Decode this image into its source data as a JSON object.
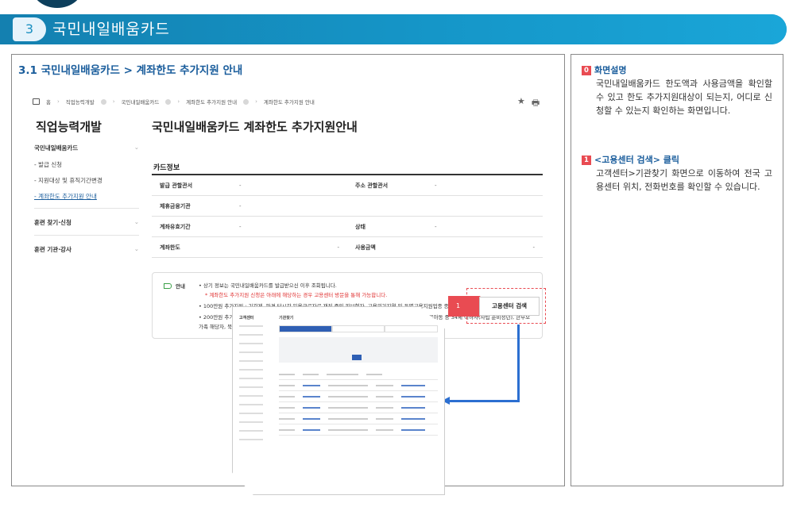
{
  "banner": {
    "number": "3",
    "title": "국민내일배움카드"
  },
  "section_title": "3.1 국민내일배움카드 > 계좌한도 추가지원 안내",
  "breadcrumb": [
    "홈",
    "직업능력개발",
    "국민내일배움카드",
    "계좌한도 추가지원 안내",
    "계좌한도 추가지원 안내"
  ],
  "tools": {
    "star": "★",
    "print": "🖶"
  },
  "nav": {
    "title": "직업능력개발",
    "groups": [
      {
        "label": "국민내일배움카드",
        "chevron": "⌄",
        "items": [
          "- 발급 신청",
          "- 지원대상 및 휴직기간변경",
          "- 계좌한도 추가지원 안내"
        ]
      },
      {
        "label": "훈련 찾기·신청",
        "chevron": "⌄"
      },
      {
        "label": "훈련 기관·강사",
        "chevron": "⌄"
      }
    ]
  },
  "content_title": "국민내일배움카드 계좌한도 추가지원안내",
  "card": {
    "label": "카드정보",
    "rows": [
      {
        "h1": "발급 관할관서",
        "v1": "-",
        "h2": "주소 관할관서",
        "v2": "-"
      },
      {
        "h1": "제휴금융기관",
        "v1": "-"
      },
      {
        "h1": "계좌유효기간",
        "v1": "-",
        "h2": "상태",
        "v2": "-"
      },
      {
        "h1": "계좌한도",
        "v1": "-",
        "h2": "사용금액",
        "v2": "-"
      }
    ]
  },
  "notice": {
    "label": "안내",
    "lines": [
      "상기 정보는 국민내일배움카드를 발급받으신 이후 조회됩니다.",
      "* 계좌한도 추가지원 신청은 아래에 해당하는 경우 고용센터 방문을 통해 가능합니다.",
      "100만원 추가지원 : 기간제, 파견 단시간,일용근로자로 재직 중인 피보험자, 고용위기지역 및 특별고용지원업종 종사자",
      "200만원 추가지원 : 출소예정자, 기초생활수급자 및 차상위 계층, 장애인, 「아동복지법」에 따른 보호종료아동 중 34세 이하자(자립 준비청년), 한부모가족 해당자, 북한이탈주민, 아프간 특별기여자"
    ]
  },
  "callout": {
    "number": "1",
    "button_label": "고용센터 검색"
  },
  "thumbnail": {
    "side_title": "고객센터",
    "main_title": "기관찾기"
  },
  "right": {
    "item0": {
      "badge": "0",
      "head": "화면설명",
      "body": "국민내일배움카드 한도액과 사용금액을 확인할 수 있고 한도 추가지원대상이 되는지, 어디로 신청할 수 있는지 확인하는 화면입니다."
    },
    "item1": {
      "badge": "1",
      "head": "<고용센터 검색> 클릭",
      "body": "고객센터>기관찾기 화면으로 이동하여 전국 고용센터 위치, 전화번호를 확인할 수 있습니다."
    }
  }
}
